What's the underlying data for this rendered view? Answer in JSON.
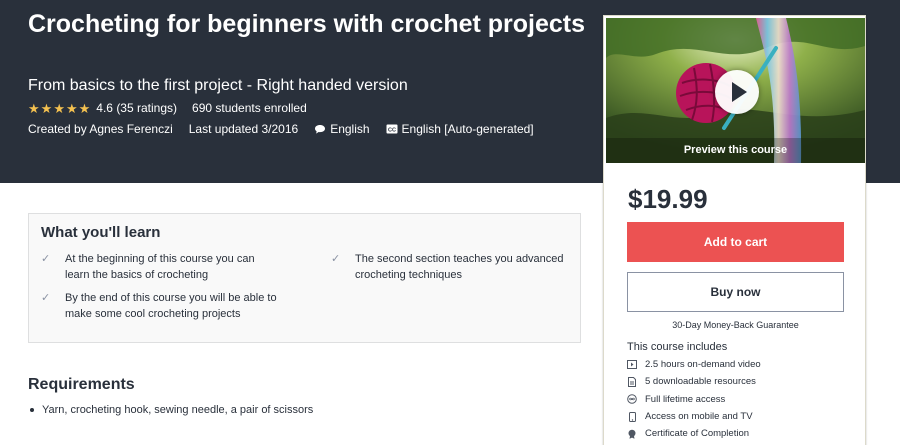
{
  "course": {
    "title": "Crocheting for beginners with crochet projects",
    "subtitle": "From basics to the first project - Right handed version",
    "rating": "4.6",
    "ratings_count": "(35 ratings)",
    "students": "690 students enrolled",
    "created_by": "Created by Agnes Ferenczi",
    "last_updated": "Last updated 3/2016",
    "language": "English",
    "captions": "English [Auto-generated]",
    "stars_filled": 4.6,
    "stars_total": 5
  },
  "sidebar": {
    "preview_label": "Preview this course",
    "price": "$19.99",
    "add_to_cart": "Add to cart",
    "buy_now": "Buy now",
    "guarantee": "30-Day Money-Back Guarantee",
    "includes_title": "This course includes",
    "includes": [
      {
        "icon": "video-icon",
        "label": "2.5 hours on-demand video"
      },
      {
        "icon": "file-icon",
        "label": "5 downloadable resources"
      },
      {
        "icon": "infinity-icon",
        "label": "Full lifetime access"
      },
      {
        "icon": "mobile-icon",
        "label": "Access on mobile and TV"
      },
      {
        "icon": "certificate-icon",
        "label": "Certificate of Completion"
      }
    ]
  },
  "learn": {
    "title": "What you'll learn",
    "items": [
      "At the beginning of this course you can learn the basics of crocheting",
      "The second section teaches you advanced crocheting techniques",
      "By the end of this course you will be able to make some cool crocheting projects"
    ]
  },
  "requirements": {
    "title": "Requirements",
    "items": [
      "Yarn, crocheting hook, sewing needle, a pair of scissors"
    ]
  },
  "colors": {
    "hero_bg": "#29303b",
    "accent": "#ec5252",
    "star": "#f4c150"
  }
}
